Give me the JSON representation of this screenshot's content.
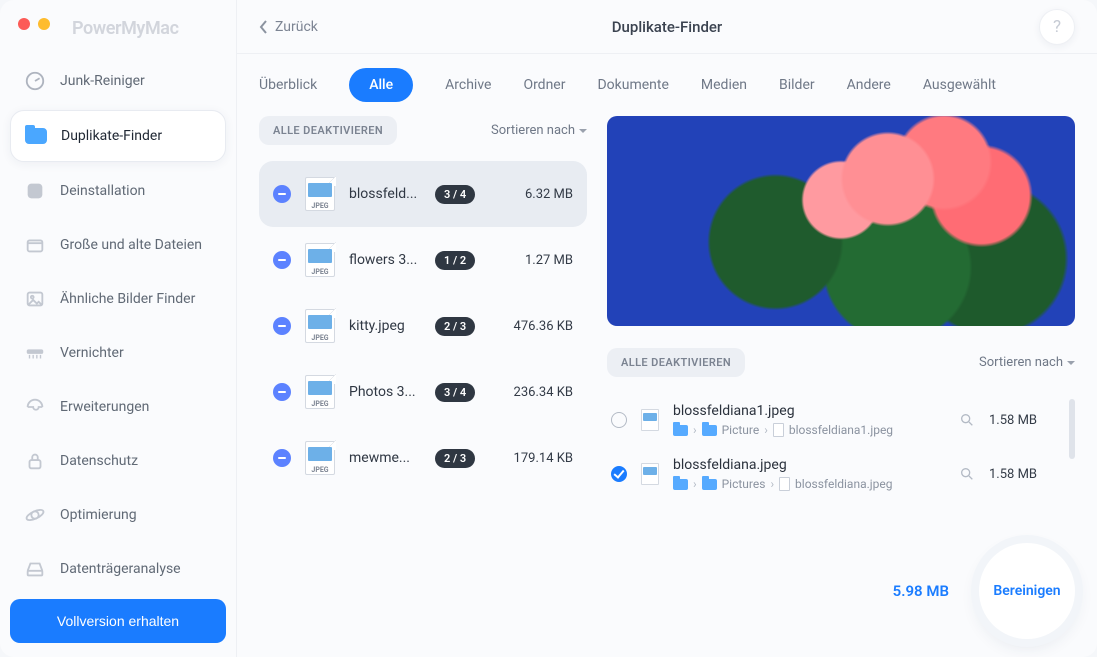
{
  "app": {
    "brand": "PowerMyMac"
  },
  "topbar": {
    "back": "Zurück",
    "title": "Duplikate-Finder",
    "help": "?"
  },
  "sidebar": {
    "items": [
      {
        "label": "Junk-Reiniger"
      },
      {
        "label": "Duplikate-Finder"
      },
      {
        "label": "Deinstallation"
      },
      {
        "label": "Große und alte Dateien"
      },
      {
        "label": "Ähnliche Bilder Finder"
      },
      {
        "label": "Vernichter"
      },
      {
        "label": "Erweiterungen"
      },
      {
        "label": "Datenschutz"
      },
      {
        "label": "Optimierung"
      },
      {
        "label": "Datenträgeranalyse"
      }
    ],
    "full_button": "Vollversion erhalten"
  },
  "tabs": {
    "items": [
      "Überblick",
      "Alle",
      "Archive",
      "Ordner",
      "Dokumente",
      "Medien",
      "Bilder",
      "Andere",
      "Ausgewählt"
    ],
    "active_index": 1
  },
  "left": {
    "deactivate_all": "ALLE DEAKTIVIEREN",
    "sort_by": "Sortieren nach",
    "thumb_type": "JPEG",
    "groups": [
      {
        "name": "blossfeld...",
        "badge": "3 / 4",
        "size": "6.32 MB"
      },
      {
        "name": "flowers 3...",
        "badge": "1 / 2",
        "size": "1.27 MB"
      },
      {
        "name": "kitty.jpeg",
        "badge": "2 / 3",
        "size": "476.36 KB"
      },
      {
        "name": "Photos 3...",
        "badge": "3 / 4",
        "size": "236.34 KB"
      },
      {
        "name": "mewme...",
        "badge": "2 / 3",
        "size": "179.14 KB"
      }
    ]
  },
  "right": {
    "deactivate_all": "ALLE DEAKTIVIEREN",
    "sort_by": "Sortieren nach",
    "files": [
      {
        "checked": false,
        "name": "blossfeldiana1.jpeg",
        "path_folder": "Picture",
        "path_file": "blossfeldiana1.jpeg",
        "size": "1.58 MB"
      },
      {
        "checked": true,
        "name": "blossfeldiana.jpeg",
        "path_folder": "Pictures",
        "path_file": "blossfeldiana.jpeg",
        "size": "1.58 MB"
      }
    ]
  },
  "footer": {
    "total": "5.98 MB",
    "scan": "Bereinigen"
  }
}
